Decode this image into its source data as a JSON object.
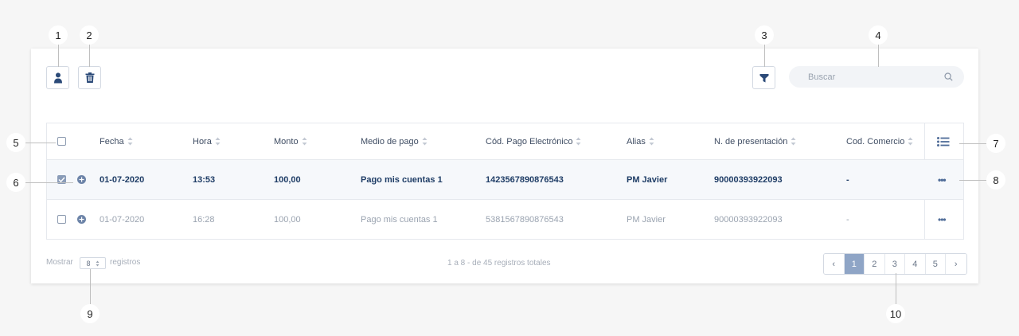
{
  "callouts": [
    "1",
    "2",
    "3",
    "4",
    "5",
    "6",
    "7",
    "8",
    "9",
    "10"
  ],
  "toolbar": {
    "user_icon": "user-icon",
    "delete_icon": "trash-icon",
    "filter_icon": "filter-icon"
  },
  "search": {
    "placeholder": "Buscar",
    "icon": "search-icon"
  },
  "table": {
    "columns": [
      "Fecha",
      "Hora",
      "Monto",
      "Medio de pago",
      "Cód. Pago Electrónico",
      "Alias",
      "N. de presentación",
      "Cod. Comercio"
    ],
    "column_menu_icon": "list-icon",
    "rows": [
      {
        "selected": true,
        "fecha": "01-07-2020",
        "hora": "13:53",
        "monto": "100,00",
        "medio": "Pago mis cuentas 1",
        "codigo": "1423567890876543",
        "alias": "PM Javier",
        "presentacion": "90000393922093",
        "comercio": "-",
        "actions": "•••"
      },
      {
        "selected": false,
        "fecha": "01-07-2020",
        "hora": "16:28",
        "monto": "100,00",
        "medio": "Pago mis cuentas 1",
        "codigo": "5381567890876543",
        "alias": "PM Javier",
        "presentacion": "90000393922093",
        "comercio": "-",
        "actions": "•••"
      }
    ]
  },
  "footer": {
    "show_label": "Mostrar",
    "page_size": "8",
    "records_label": "registros",
    "summary": "1 a 8 - de 45 registros totales"
  },
  "pagination": {
    "prev": "‹",
    "pages": [
      "1",
      "2",
      "3",
      "4",
      "5"
    ],
    "active": "1",
    "next": "›"
  },
  "colors": {
    "accent": "#8fa5c6",
    "text_primary": "#1f3d66",
    "text_muted": "#9aa3b0",
    "background": "#f6f6f6"
  }
}
